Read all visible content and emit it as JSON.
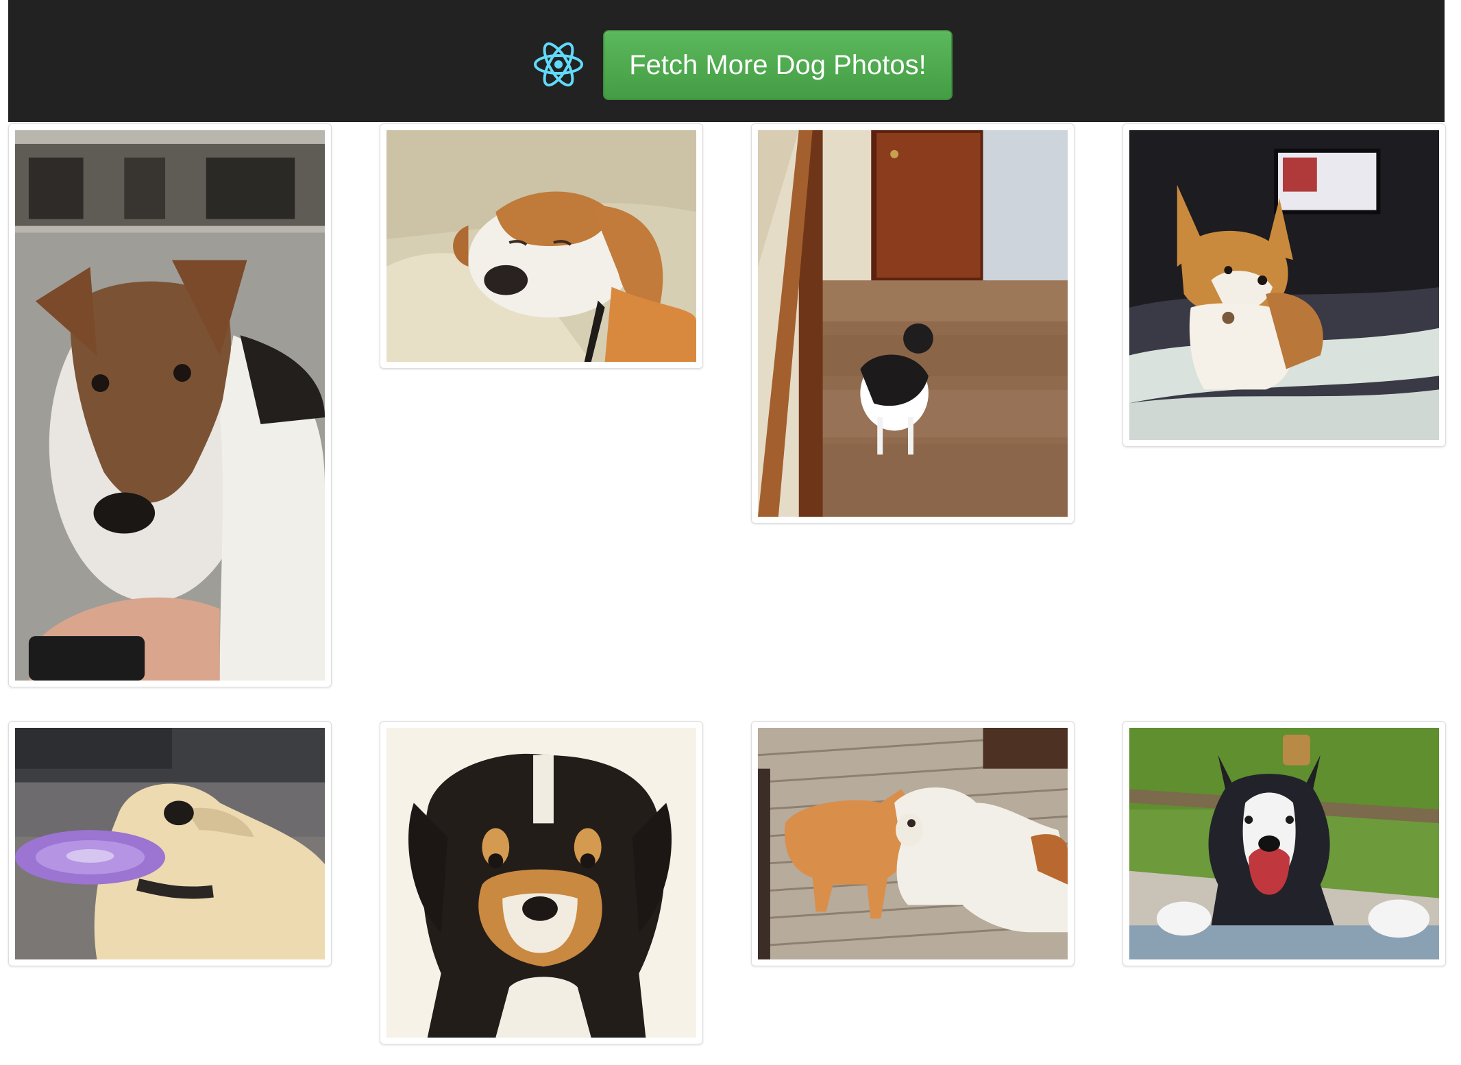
{
  "header": {
    "logo_icon": "react-atom-icon",
    "fetch_button_label": "Fetch More Dog Photos!",
    "background": "#222222",
    "button_color": "#4cae4c"
  },
  "photos": [
    {
      "subject": "jack-russell-terrier",
      "alt": ""
    },
    {
      "subject": "sleeping-beagle",
      "alt": ""
    },
    {
      "subject": "cat-on-stairs",
      "alt": ""
    },
    {
      "subject": "corgi-on-bed",
      "alt": ""
    },
    {
      "subject": "dog-catching-frisbee",
      "alt": ""
    },
    {
      "subject": "puppy-portrait",
      "alt": ""
    },
    {
      "subject": "cat-and-bulldog",
      "alt": ""
    },
    {
      "subject": "smiling-husky",
      "alt": ""
    }
  ]
}
